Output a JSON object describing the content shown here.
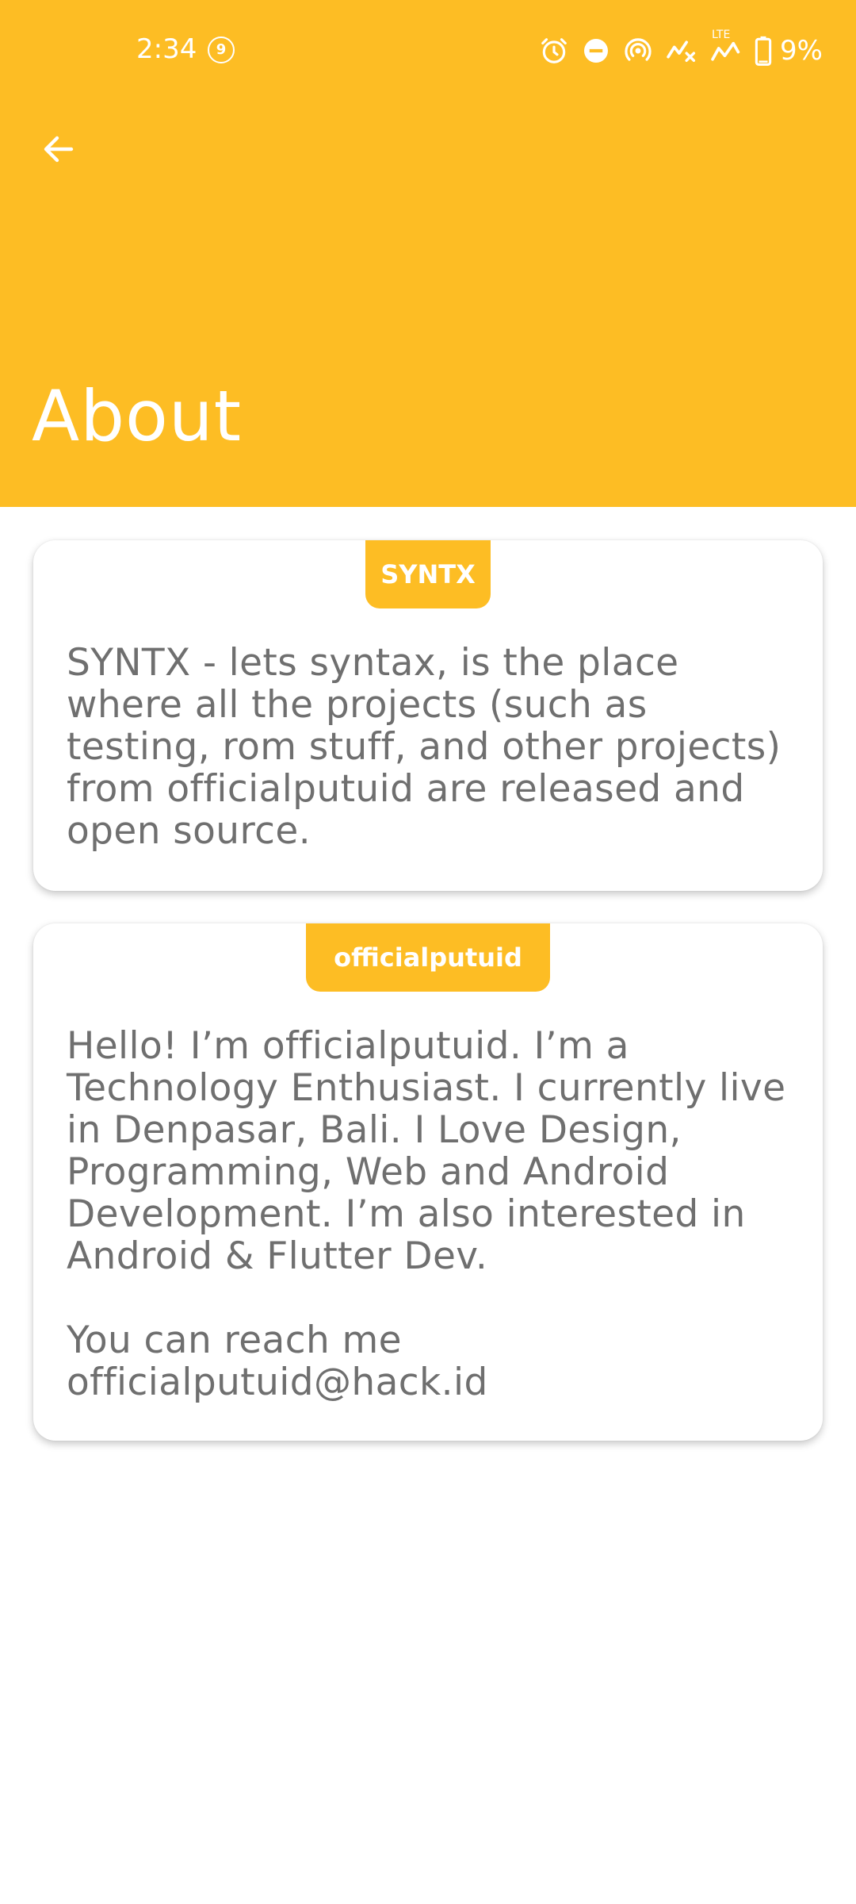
{
  "status_bar": {
    "time": "2:34",
    "notification_count": "9",
    "battery": "9%",
    "network": "LTE",
    "icons": [
      "alarm-icon",
      "do-not-disturb-icon",
      "hotspot-icon",
      "signal-no-data-icon",
      "lte-signal-icon",
      "battery-icon"
    ]
  },
  "header": {
    "back_icon": "arrow-back-icon",
    "title": "About",
    "color": "#FDBD24"
  },
  "cards": {
    "syntx": {
      "badge": "SYNTX",
      "description": "SYNTX - lets syntax, is the place where all the projects (such as testing, rom stuff, and other projects) from officialputuid are released and open source."
    },
    "author": {
      "badge": "officialputuid",
      "bio": "Hello! I’m officialputuid. I’m a Technology Enthusiast. I currently live in Denpasar, Bali. I Love Design, Programming, Web and Android Development. I’m also interested in Android & Flutter Dev.",
      "contact_label": "You can reach me",
      "email": "officialputuid@hack.id"
    }
  },
  "colors": {
    "accent": "#FDBD24",
    "text_secondary": "#6F6F6F",
    "background": "#FFFFFF"
  }
}
